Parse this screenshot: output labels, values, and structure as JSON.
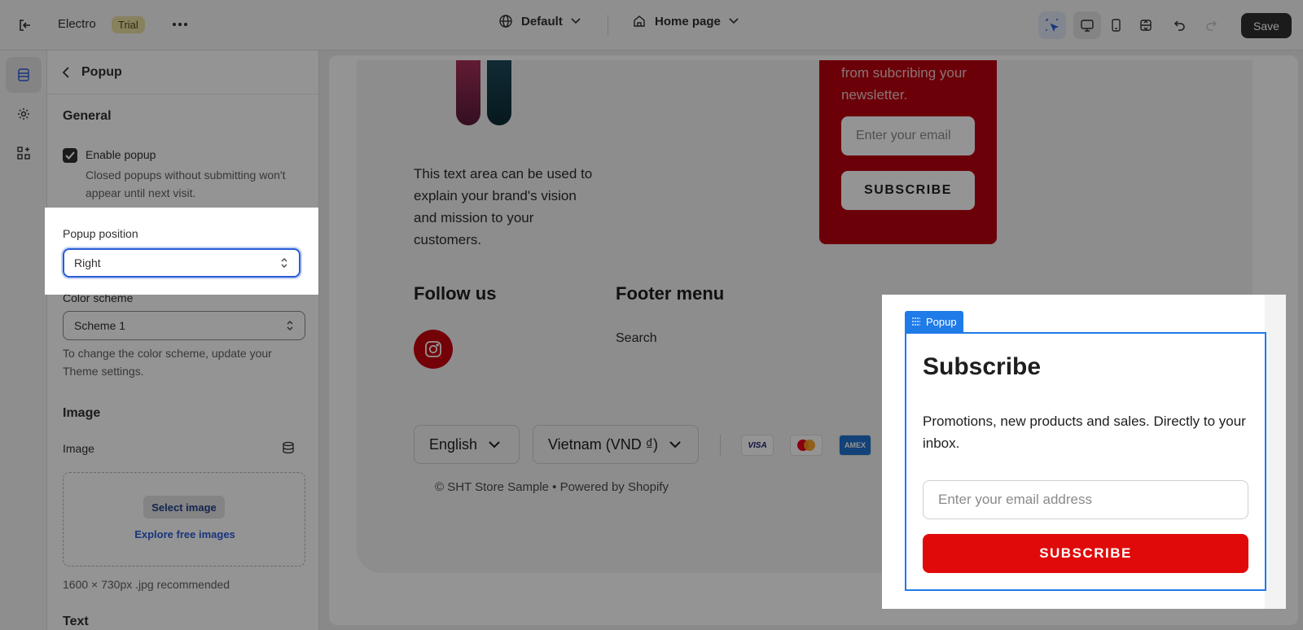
{
  "topbar": {
    "store_name": "Electro",
    "trial_badge": "Trial",
    "theme_label": "Default",
    "page_label": "Home page",
    "save_label": "Save"
  },
  "panel": {
    "back_title": "Popup",
    "general_heading": "General",
    "enable_popup_label": "Enable popup",
    "enable_popup_checked": true,
    "enable_popup_help": "Closed popups without submitting won't appear until next visit.",
    "popup_position_label": "Popup position",
    "popup_position_value": "Right",
    "color_scheme_label": "Color scheme",
    "color_scheme_value": "Scheme 1",
    "color_scheme_help": "To change the color scheme, update your Theme settings.",
    "image_heading": "Image",
    "image_label": "Image",
    "select_image_label": "Select image",
    "explore_images_label": "Explore free images",
    "image_help": "1600 × 730px .jpg recommended",
    "text_heading": "Text"
  },
  "preview": {
    "about_text": "This text area can be used to explain your brand's vision and mission to your customers.",
    "newsletter_text": "from subcribing your newsletter.",
    "newsletter_placeholder": "Enter your email",
    "newsletter_button": "SUBSCRIBE",
    "follow_title": "Follow us",
    "footer_menu_title": "Footer menu",
    "footer_menu_link": "Search",
    "language": "English",
    "country": "Vietnam (VND ₫)",
    "payments": [
      "VISA",
      "",
      "AMEX"
    ],
    "copyright": "© SHT Store Sample • Powered by Shopify"
  },
  "popup": {
    "tag": "Popup",
    "title": "Subscribe",
    "description": "Promotions, new products and sales. Directly to your inbox.",
    "email_placeholder": "Enter your email address",
    "button": "SUBSCRIBE"
  },
  "colors": {
    "accent": "#2a5bd7",
    "brand_red": "#e10a0a",
    "selection_blue": "#1f7be8"
  }
}
